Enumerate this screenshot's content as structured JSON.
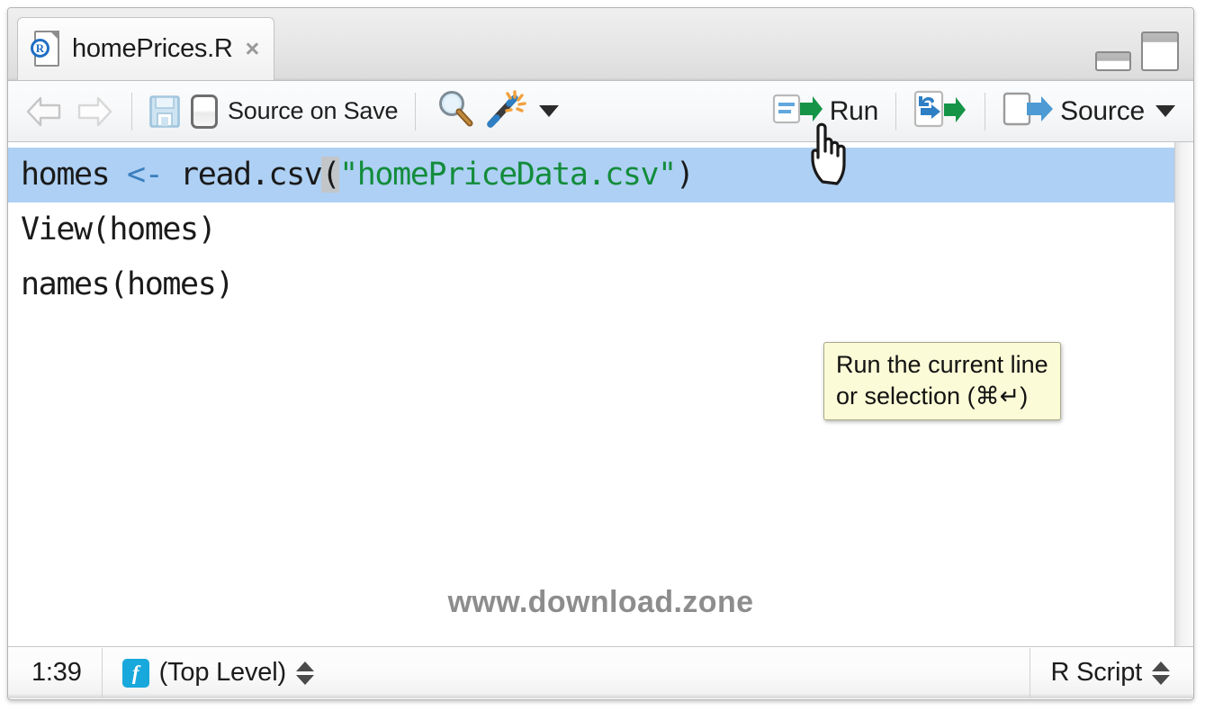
{
  "window": {
    "minimize_label": "minimize-pane",
    "maximize_label": "maximize-pane"
  },
  "tab": {
    "title": "homePrices.R",
    "close_label": "×",
    "icon": "r-script-file-icon"
  },
  "toolbar": {
    "back_label": "back-arrow-icon",
    "forward_label": "forward-arrow-icon",
    "save_label": "save-icon",
    "source_on_save_label": "Source on Save",
    "find_label": "find-replace-icon",
    "code_tools_label": "code-tools-magic-wand-icon",
    "code_tools_caret": "chevron-down-icon",
    "run_label": "Run",
    "rerun_label": "re-run-previous-code-icon",
    "source_label": "Source",
    "source_caret": "chevron-down-icon"
  },
  "tooltip": {
    "line1": "Run the current line",
    "line2": "or selection (⌘↵)"
  },
  "editor": {
    "lines": [
      {
        "selected": true,
        "segments": [
          {
            "text": "homes ",
            "type": "plain"
          },
          {
            "text": "<- ",
            "type": "operator"
          },
          {
            "text": "read.csv",
            "type": "plain"
          },
          {
            "text": "(",
            "type": "paren-match"
          },
          {
            "text": "\"homePriceData.csv\"",
            "type": "string"
          },
          {
            "text": ")",
            "type": "plain"
          }
        ]
      },
      {
        "selected": false,
        "segments": [
          {
            "text": "View(homes)",
            "type": "plain"
          }
        ]
      },
      {
        "selected": false,
        "segments": [
          {
            "text": "names(homes)",
            "type": "plain"
          }
        ]
      }
    ],
    "watermark": "www.download.zone",
    "selection_color": "#aed0f4",
    "string_color": "#138c3c",
    "operator_color": "#3a7fbe"
  },
  "status_bar": {
    "cursor_position": "1:39",
    "scope": "(Top Level)",
    "scope_icon": "function-icon",
    "file_type": "R Script"
  },
  "cursor": {
    "type": "pointing-hand-cursor"
  }
}
